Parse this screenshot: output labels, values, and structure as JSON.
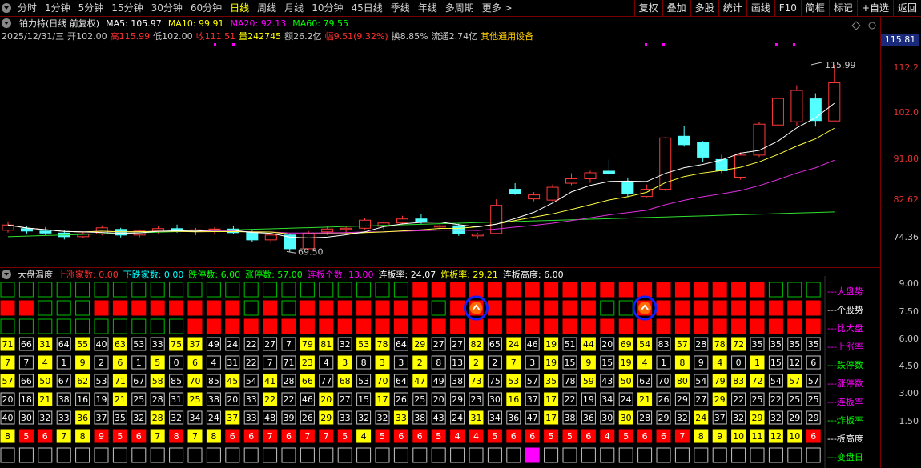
{
  "toolbar": {
    "tabs": [
      "分时",
      "1分钟",
      "5分钟",
      "15分钟",
      "30分钟",
      "60分钟",
      "日线",
      "周线",
      "月线",
      "10分钟",
      "45日线",
      "季线",
      "年线",
      "多周期",
      "更多 >"
    ],
    "active": "日线",
    "right": [
      "复权",
      "叠加",
      "多股",
      "统计",
      "画线",
      "F10",
      "简框",
      "标记",
      "+自选",
      "返回"
    ]
  },
  "header": {
    "title": "铂力特(日线 前复权)",
    "ma": [
      {
        "label": "MA5: 105.97",
        "color": "#ffffff"
      },
      {
        "label": "MA10: 99.91",
        "color": "#ffff00"
      },
      {
        "label": "MA20: 92.13",
        "color": "#ff00ff"
      },
      {
        "label": "MA60: 79.55",
        "color": "#00ff00"
      }
    ]
  },
  "info": [
    {
      "t": "2025/12/31/三",
      "c": "#c8c8c8"
    },
    {
      "t": "开102.00",
      "c": "#c8c8c8"
    },
    {
      "t": "高115.99",
      "c": "#ff3030"
    },
    {
      "t": "低102.00",
      "c": "#c8c8c8"
    },
    {
      "t": "收111.51",
      "c": "#ff3030"
    },
    {
      "t": "量242745",
      "c": "#ffff00"
    },
    {
      "t": "额26.2亿",
      "c": "#c8c8c8"
    },
    {
      "t": "幅9.51(9.32%)",
      "c": "#ff3030"
    },
    {
      "t": "换8.85%",
      "c": "#c8c8c8"
    },
    {
      "t": "流通2.74亿",
      "c": "#c8c8c8"
    },
    {
      "t": "其他通用设备",
      "c": "#ffcc00"
    }
  ],
  "price_axis": {
    "labels": [
      "112.2",
      "102.0",
      "91.80",
      "82.62",
      "74.36"
    ],
    "current": "115.81",
    "high_label": "115.99",
    "low_label": "69.50"
  },
  "indicator": {
    "title": "大盘温度",
    "stats": [
      {
        "t": "上涨家数: 0.00",
        "c": "#ff3030"
      },
      {
        "t": "下跌家数: 0.00",
        "c": "#00ffff"
      },
      {
        "t": "跌停数: 6.00",
        "c": "#00ff00"
      },
      {
        "t": "涨停数: 57.00",
        "c": "#00ff00"
      },
      {
        "t": "连板个数: 13.00",
        "c": "#ff00ff"
      },
      {
        "t": "连板率: 24.07",
        "c": "#ffffff"
      },
      {
        "t": "炸板率: 29.21",
        "c": "#ffff00"
      },
      {
        "t": "连板高度: 6.00",
        "c": "#ffffff"
      }
    ],
    "axis": [
      "9.00",
      "7.50",
      "6.00",
      "4.50",
      "3.00",
      "1.50"
    ],
    "row_labels": [
      {
        "t": "---大盘势",
        "c": "#ff00ff"
      },
      {
        "t": "---个股势",
        "c": "#ffffff"
      },
      {
        "t": "---比大盘",
        "c": "#ff00ff"
      },
      {
        "t": "---上涨率",
        "c": "#ff00ff"
      },
      {
        "t": "---跌停数",
        "c": "#00ff00"
      },
      {
        "t": "---涨停数",
        "c": "#ff00ff"
      },
      {
        "t": "---连板率",
        "c": "#ff00ff"
      },
      {
        "t": "---炸板率",
        "c": "#00ff00"
      },
      {
        "t": "---板高度",
        "c": "#ffffff"
      },
      {
        "t": "---变盘日",
        "c": "#00ff00"
      }
    ],
    "rows": [
      [
        "71",
        "66",
        "31",
        "64",
        "55",
        "40",
        "63",
        "53",
        "33",
        "75",
        "37",
        "49",
        "24",
        "22",
        "27",
        "7",
        "79",
        "81",
        "32",
        "53",
        "78",
        "64",
        "29",
        "27",
        "27",
        "82",
        "65",
        "24",
        "46",
        "19",
        "51",
        "44",
        "20",
        "69",
        "54",
        "83",
        "57",
        "28",
        "78",
        "72",
        "35",
        "35",
        "35",
        "35"
      ],
      [
        "7",
        "7",
        "4",
        "1",
        "9",
        "2",
        "6",
        "1",
        "5",
        "0",
        "6",
        "4",
        "31",
        "22",
        "7",
        "71",
        "23",
        "4",
        "3",
        "8",
        "3",
        "3",
        "2",
        "8",
        "13",
        "2",
        "2",
        "7",
        "3",
        "19",
        "15",
        "9",
        "15",
        "19",
        "4",
        "1",
        "8",
        "9",
        "4",
        "0",
        "1",
        "15",
        "12",
        "6"
      ],
      [
        "57",
        "66",
        "50",
        "67",
        "62",
        "53",
        "71",
        "67",
        "58",
        "85",
        "70",
        "85",
        "45",
        "54",
        "41",
        "28",
        "66",
        "77",
        "68",
        "53",
        "70",
        "64",
        "47",
        "49",
        "38",
        "73",
        "75",
        "53",
        "57",
        "35",
        "78",
        "59",
        "43",
        "50",
        "62",
        "70",
        "80",
        "54",
        "79",
        "83",
        "72",
        "54",
        "57",
        "57"
      ],
      [
        "20",
        "18",
        "21",
        "38",
        "16",
        "19",
        "21",
        "25",
        "28",
        "31",
        "25",
        "38",
        "20",
        "33",
        "22",
        "22",
        "46",
        "20",
        "27",
        "15",
        "17",
        "26",
        "25",
        "20",
        "29",
        "23",
        "30",
        "16",
        "37",
        "17",
        "22",
        "19",
        "34",
        "24",
        "21",
        "26",
        "29",
        "27",
        "29",
        "22",
        "25",
        "22",
        "25",
        "25"
      ],
      [
        "40",
        "30",
        "32",
        "33",
        "36",
        "37",
        "35",
        "32",
        "28",
        "32",
        "34",
        "24",
        "37",
        "33",
        "48",
        "39",
        "26",
        "29",
        "33",
        "32",
        "32",
        "33",
        "38",
        "43",
        "24",
        "31",
        "34",
        "36",
        "47",
        "17",
        "38",
        "36",
        "30",
        "30",
        "28",
        "29",
        "32",
        "24",
        "37",
        "32",
        "29",
        "32",
        "29",
        "29"
      ],
      [
        "8",
        "5",
        "6",
        "7",
        "8",
        "9",
        "5",
        "6",
        "7",
        "8",
        "7",
        "8",
        "6",
        "6",
        "7",
        "6",
        "7",
        "7",
        "5",
        "4",
        "5",
        "6",
        "6",
        "5",
        "4",
        "4",
        "5",
        "6",
        "6",
        "5",
        "5",
        "6",
        "4",
        "5",
        "6",
        "6",
        "7",
        "8",
        "9",
        "10",
        "11",
        "12",
        "10",
        "6"
      ]
    ]
  }
}
